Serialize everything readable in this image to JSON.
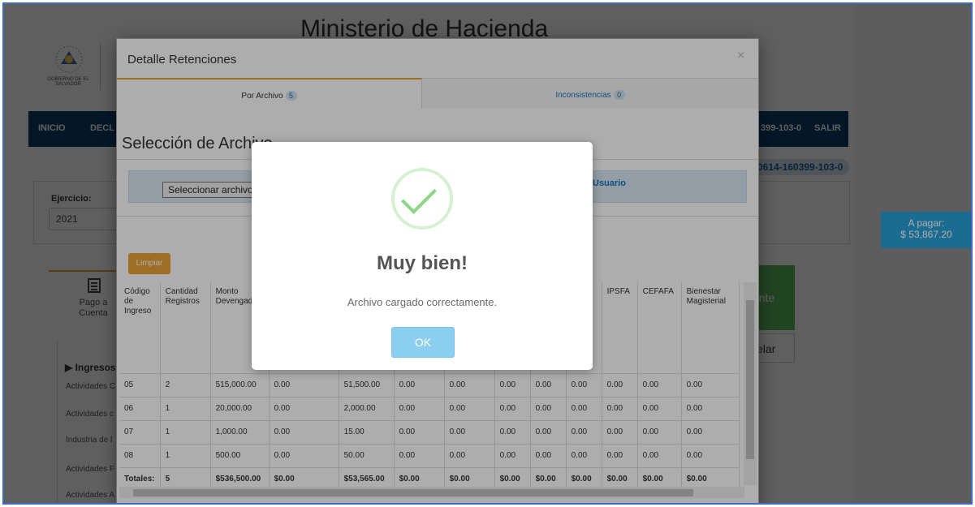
{
  "background": {
    "title": "Ministerio de Hacienda",
    "logo_text": "GOBIERNO DE EL SALVADOR",
    "nav": {
      "inicio": "INICIO",
      "decl": "DECL",
      "nit_short": "399-103-0",
      "salir": "SALIR"
    },
    "nit_badge": "0614-160399-103-0",
    "ejercicio_label": "Ejercicio:",
    "ejercicio_value": "2021",
    "pago_tab": "Pago a Cuenta",
    "green_btn_text": "ente",
    "cancel_btn_text": "elar",
    "ingresos_title": "Ingresos",
    "ingresos_items": [
      "Actividades C",
      "Actividades c",
      "Industria de l",
      "Actividades F",
      "Actividades A"
    ],
    "a_pagar_label": "A pagar:",
    "a_pagar_value": "$ 53,867.20"
  },
  "modal": {
    "title": "Detalle Retenciones",
    "close_icon": "×",
    "tabs": [
      {
        "label": "Por Archivo",
        "count": "5"
      },
      {
        "label": "Inconsistencias",
        "count": "0"
      }
    ],
    "heading": "Selección de Archivo",
    "file_select": "Seleccionar archivo",
    "usuario_label": "Usuario",
    "limpiar_button": "Limpiar",
    "table": {
      "headers": [
        "Código de Ingreso",
        "Cantidad Registros",
        "Monto Devengado",
        "",
        "",
        "",
        "",
        "",
        "",
        "",
        "IPSFA",
        "CEFAFA",
        "Bienestar Magisterial"
      ],
      "rows": [
        [
          "05",
          "2",
          "515,000.00",
          "0.00",
          "51,500.00",
          "0.00",
          "0.00",
          "0.00",
          "0.00",
          "0.00",
          "0.00",
          "0.00",
          "0.00"
        ],
        [
          "06",
          "1",
          "20,000.00",
          "0.00",
          "2,000.00",
          "0.00",
          "0.00",
          "0.00",
          "0.00",
          "0.00",
          "0.00",
          "0.00",
          "0.00"
        ],
        [
          "07",
          "1",
          "1,000.00",
          "0.00",
          "15.00",
          "0.00",
          "0.00",
          "0.00",
          "0.00",
          "0.00",
          "0.00",
          "0.00",
          "0.00"
        ],
        [
          "08",
          "1",
          "500.00",
          "0.00",
          "50.00",
          "0.00",
          "0.00",
          "0.00",
          "0.00",
          "0.00",
          "0.00",
          "0.00",
          "0.00"
        ]
      ],
      "totals": [
        "Totales:",
        "5",
        "$536,500.00",
        "$0.00",
        "$53,565.00",
        "$0.00",
        "$0.00",
        "$0.00",
        "$0.00",
        "$0.00",
        "$0.00",
        "$0.00",
        "$0.00"
      ]
    }
  },
  "dialog": {
    "icon": "success-check-icon",
    "title": "Muy bien!",
    "message": "Archivo cargado correctamente.",
    "ok_button": "OK"
  },
  "colors": {
    "nav": "#0a3f6b",
    "accent_orange": "#e8a336",
    "pay_blue": "#2a9fd6",
    "ok_button": "#8ccef0",
    "check_green": "#8bd687"
  }
}
